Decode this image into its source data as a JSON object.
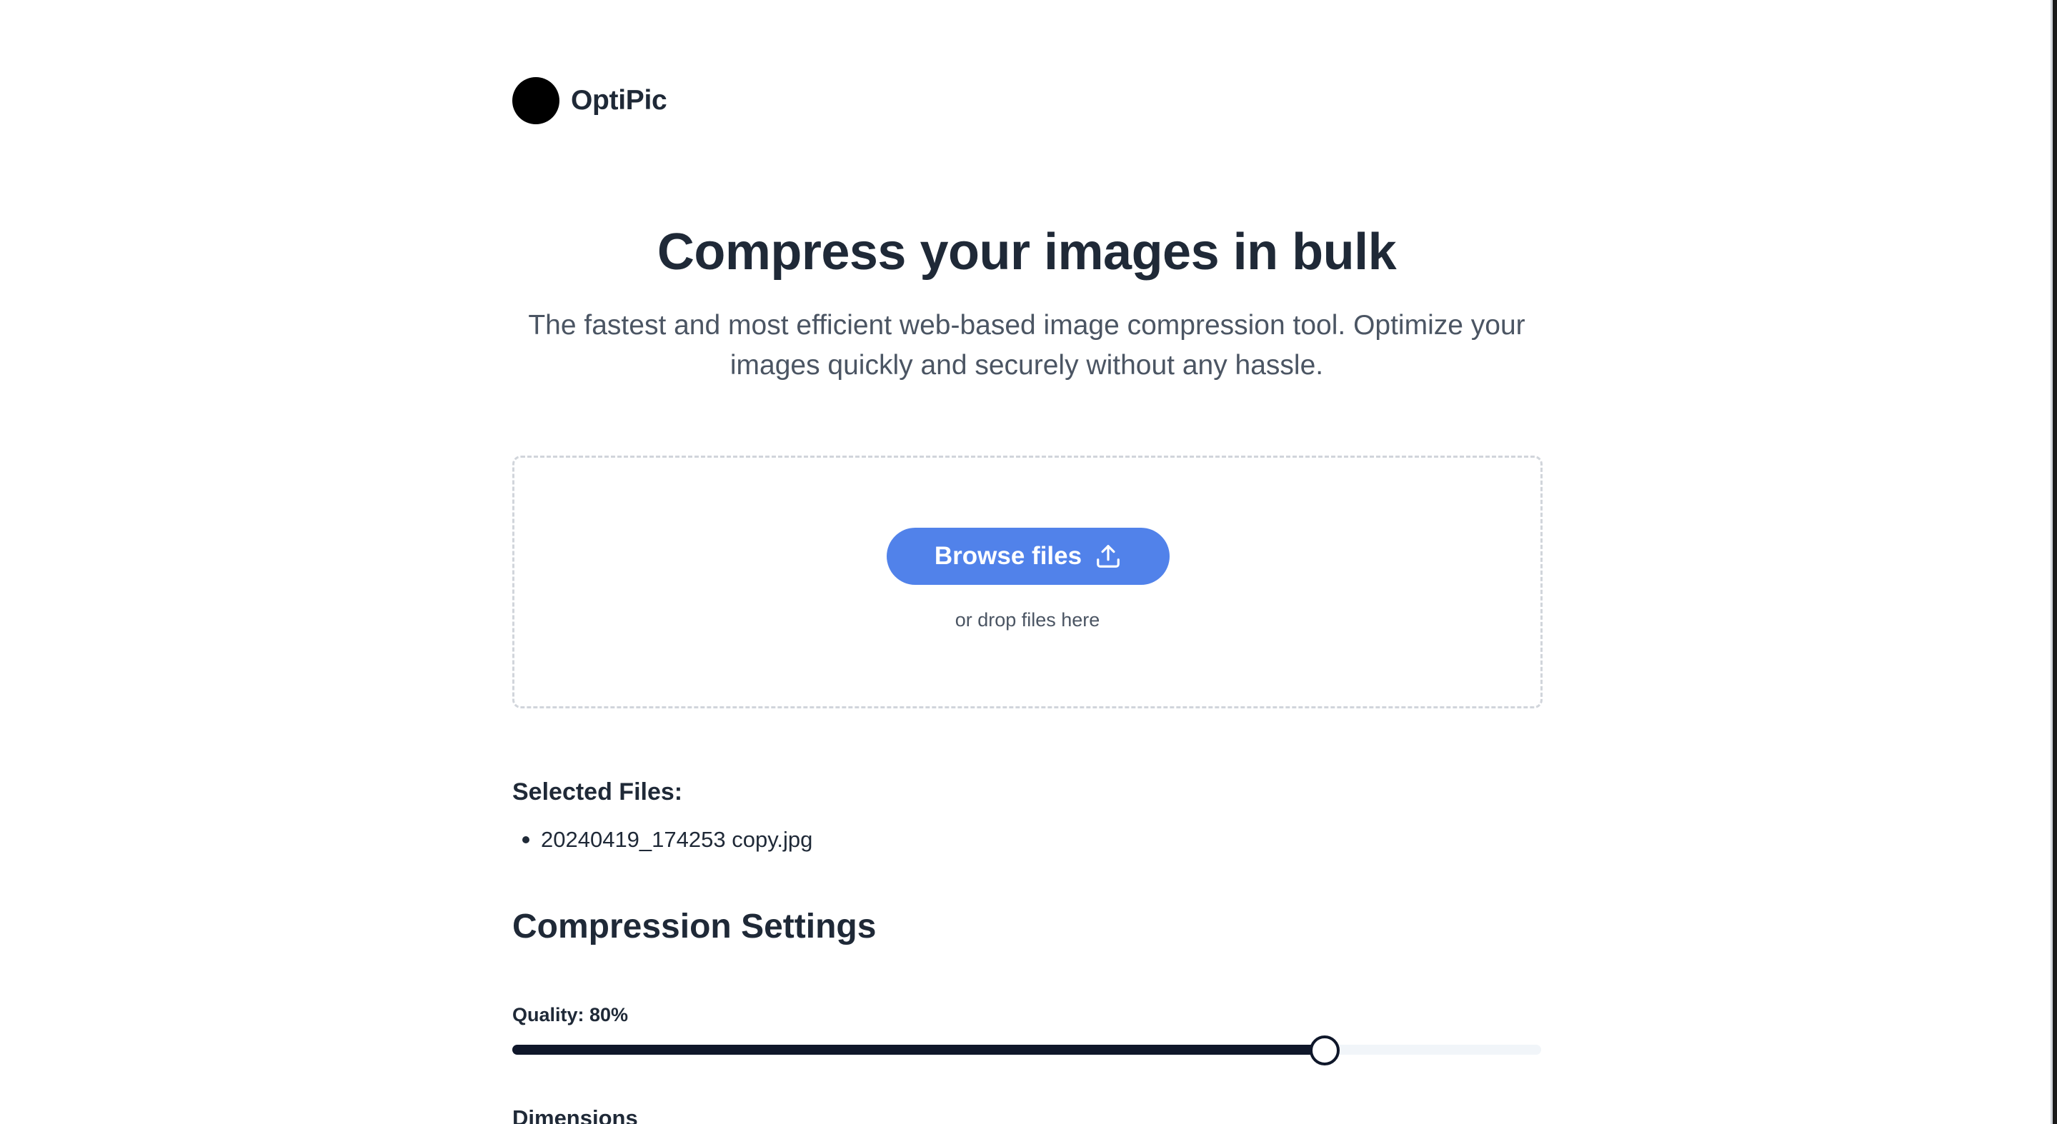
{
  "brand": {
    "name": "OptiPic",
    "logo_icon": "black-circle-logo"
  },
  "hero": {
    "title": "Compress your images in bulk",
    "subtitle": "The fastest and most efficient web-based image compression tool. Optimize your images quickly and securely without any hassle."
  },
  "dropzone": {
    "browse_label": "Browse files",
    "browse_icon": "upload-icon",
    "hint": "or drop files here",
    "button_color": "#5182ea"
  },
  "selected_files": {
    "heading": "Selected Files:",
    "files": [
      "20240419_174253 copy.jpg"
    ]
  },
  "settings": {
    "heading": "Compression Settings",
    "quality_label": "Quality: 80%",
    "quality_value": 80,
    "quality_max": 100,
    "dimensions_heading": "Dimensions"
  },
  "colors": {
    "text": "#1f2937",
    "slider_fill": "#0f172a",
    "slider_track": "#f1f5f9"
  }
}
